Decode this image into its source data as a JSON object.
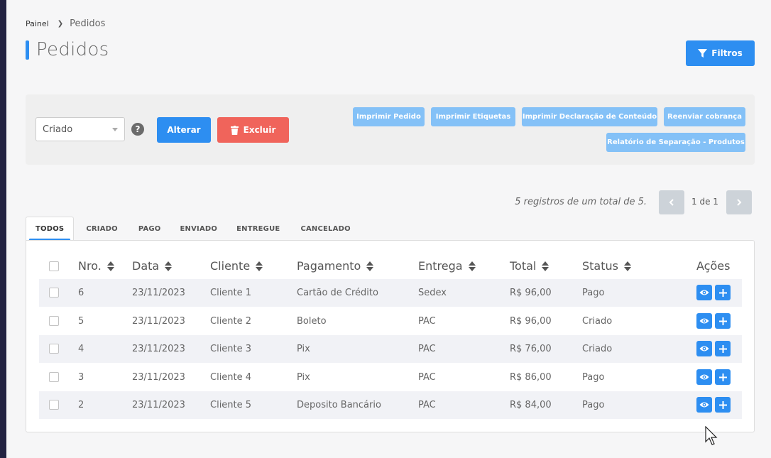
{
  "breadcrumb": {
    "home": "Painel",
    "current": "Pedidos"
  },
  "page_title": "Pedidos",
  "filtros_label": "Filtros",
  "actions": {
    "status_select_value": "Criado",
    "help_glyph": "?",
    "alterar_label": "Alterar",
    "excluir_label": "Excluir",
    "buttons": [
      "Imprimir Pedido",
      "Imprimir Etiquetas",
      "Imprimir Declaração de Conteúdo",
      "Reenviar cobrança",
      "Relatório de Separação - Produtos"
    ]
  },
  "pagination": {
    "info": "5 registros de um total de 5.",
    "label": "1 de 1"
  },
  "tabs": [
    "TODOS",
    "CRIADO",
    "PAGO",
    "ENVIADO",
    "ENTREGUE",
    "CANCELADO"
  ],
  "table": {
    "headers": [
      "Nro.",
      "Data",
      "Cliente",
      "Pagamento",
      "Entrega",
      "Total",
      "Status",
      "Ações"
    ],
    "rows": [
      {
        "nro": "6",
        "data": "23/11/2023",
        "cliente": "Cliente 1",
        "pagamento": "Cartão de Crédito",
        "entrega": "Sedex",
        "total": "R$ 96,00",
        "status": "Pago"
      },
      {
        "nro": "5",
        "data": "23/11/2023",
        "cliente": "Cliente 2",
        "pagamento": "Boleto",
        "entrega": "PAC",
        "total": "R$ 96,00",
        "status": "Criado"
      },
      {
        "nro": "4",
        "data": "23/11/2023",
        "cliente": "Cliente 3",
        "pagamento": "Pix",
        "entrega": "PAC",
        "total": "R$ 76,00",
        "status": "Criado"
      },
      {
        "nro": "3",
        "data": "23/11/2023",
        "cliente": "Cliente 4",
        "pagamento": "Pix",
        "entrega": "PAC",
        "total": "R$ 86,00",
        "status": "Pago"
      },
      {
        "nro": "2",
        "data": "23/11/2023",
        "cliente": "Cliente 5",
        "pagamento": "Deposito Bancário",
        "entrega": "PAC",
        "total": "R$ 84,00",
        "status": "Pago"
      }
    ]
  },
  "colors": {
    "primary": "#2d8ef1",
    "danger": "#f0645b",
    "light_button": "#84c1f7",
    "sidebar": "#232342"
  }
}
